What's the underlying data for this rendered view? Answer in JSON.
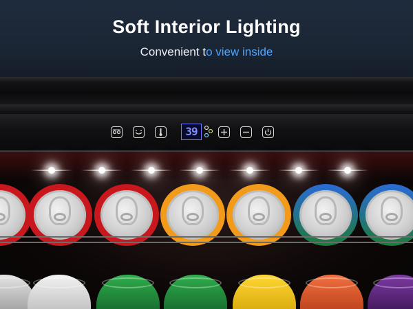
{
  "header": {
    "title": "Soft Interior Lighting",
    "subtitle_part1": "Convenient t",
    "subtitle_part2": "o view inside",
    "colors": {
      "accent": "#4ea3ff",
      "background": "#1b2635"
    }
  },
  "control_panel": {
    "temperature_display": "39",
    "icons": [
      "light-icon",
      "mode-icon",
      "thermometer-icon",
      "fan-icon",
      "plus-icon",
      "minus-icon",
      "power-icon"
    ],
    "display_color": "#6f7cff"
  },
  "interior": {
    "led_count": 7,
    "top_row_can_colors": [
      "#c8181e",
      "#c8181e",
      "#c8181e",
      "#f29a1a",
      "#f29a1a",
      "#1d7a3a",
      "#2b6bd6"
    ],
    "bottom_row_can_colors": [
      "#cfcfcf",
      "#e9e9e9",
      "#1f8f3a",
      "#1f8f3a",
      "#f3c514",
      "#e2572f",
      "#6a2a8a"
    ]
  }
}
